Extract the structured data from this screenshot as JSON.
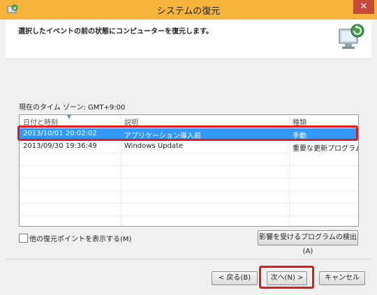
{
  "window": {
    "title": "システムの復元",
    "close_label": "✕"
  },
  "header": {
    "message": "選択したイベントの前の状態にコンピューターを復元します。"
  },
  "timezone_text": "現在のタイム ゾーン: GMT+9:00",
  "table": {
    "columns": [
      "日付と時刻",
      "説明",
      "種類"
    ],
    "rows": [
      {
        "datetime": "2013/10/01 20:02:02",
        "description": "アプリケーション導入前",
        "type": "手動",
        "selected": true
      },
      {
        "datetime": "2013/09/30 19:36:49",
        "description": "Windows Update",
        "type": "重要な更新プログラム",
        "selected": false
      }
    ]
  },
  "show_more_checkbox": {
    "label": "他の復元ポイントを表示する(M)",
    "checked": false
  },
  "buttons": {
    "detect": "影響を受けるプログラムの検出(A)",
    "back": "< 戻る(B)",
    "next": "次へ(N) >",
    "cancel": "キャンセル"
  },
  "colors": {
    "titlebar": "#f7b43c",
    "selection": "#3399ff",
    "highlight_box": "#e11a1a"
  }
}
